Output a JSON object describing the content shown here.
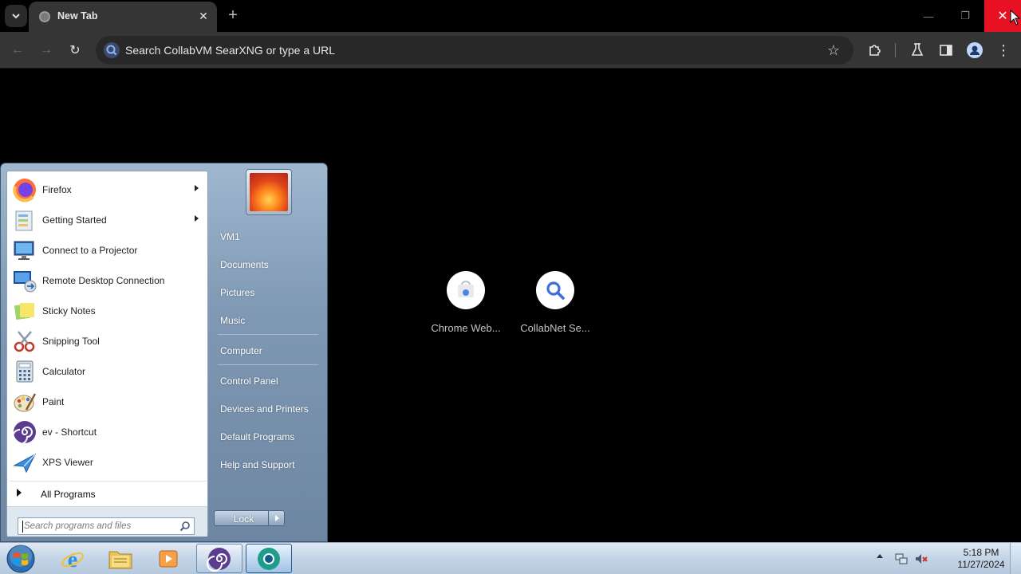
{
  "browser": {
    "tab": {
      "title": "New Tab",
      "close_glyph": "✕"
    },
    "new_tab_glyph": "+",
    "window_controls": {
      "minimize": "—",
      "restore": "❐",
      "close": "✕"
    },
    "nav": {
      "back": "←",
      "forward": "→",
      "reload": "↻"
    },
    "omnibox": {
      "placeholder": "Search CollabVM SearXNG or type a URL"
    },
    "star_glyph": "☆",
    "menu_glyph": "⋮",
    "shortcuts": [
      {
        "label": "Chrome Web...",
        "icon": "chrome-web-store-icon"
      },
      {
        "label": "CollabNet Se...",
        "icon": "search-icon"
      }
    ],
    "close_button_color": "#e81123"
  },
  "start_menu": {
    "programs": [
      {
        "label": "Firefox",
        "icon": "firefox-icon",
        "submenu": true
      },
      {
        "label": "Getting Started",
        "icon": "getting-started-icon",
        "submenu": true
      },
      {
        "label": "Connect to a Projector",
        "icon": "projector-icon",
        "submenu": false
      },
      {
        "label": "Remote Desktop Connection",
        "icon": "remote-desktop-icon",
        "submenu": false
      },
      {
        "label": "Sticky Notes",
        "icon": "sticky-notes-icon",
        "submenu": false
      },
      {
        "label": "Snipping Tool",
        "icon": "snipping-tool-icon",
        "submenu": false
      },
      {
        "label": "Calculator",
        "icon": "calculator-icon",
        "submenu": false
      },
      {
        "label": "Paint",
        "icon": "paint-icon",
        "submenu": false
      },
      {
        "label": "ev - Shortcut",
        "icon": "ev-icon",
        "submenu": false
      },
      {
        "label": "XPS Viewer",
        "icon": "xps-viewer-icon",
        "submenu": false
      }
    ],
    "all_programs": "All Programs",
    "search_placeholder": "Search programs and files",
    "right_items": [
      {
        "label": "VM1"
      },
      {
        "label": "Documents"
      },
      {
        "label": "Pictures"
      },
      {
        "label": "Music"
      },
      {
        "label": "Computer"
      },
      {
        "label": "Control Panel"
      },
      {
        "label": "Devices and Printers"
      },
      {
        "label": "Default Programs"
      },
      {
        "label": "Help and Support"
      }
    ],
    "lock_label": "Lock"
  },
  "taskbar": {
    "apps": [
      {
        "name": "internet-explorer",
        "icon": "ie-icon"
      },
      {
        "name": "windows-explorer",
        "icon": "folder-icon"
      },
      {
        "name": "media-player",
        "icon": "media-player-icon"
      },
      {
        "name": "ev",
        "icon": "ev-icon"
      },
      {
        "name": "chrome",
        "icon": "chrome-icon"
      }
    ],
    "clock": {
      "time": "5:18 PM",
      "date": "11/27/2024"
    }
  }
}
